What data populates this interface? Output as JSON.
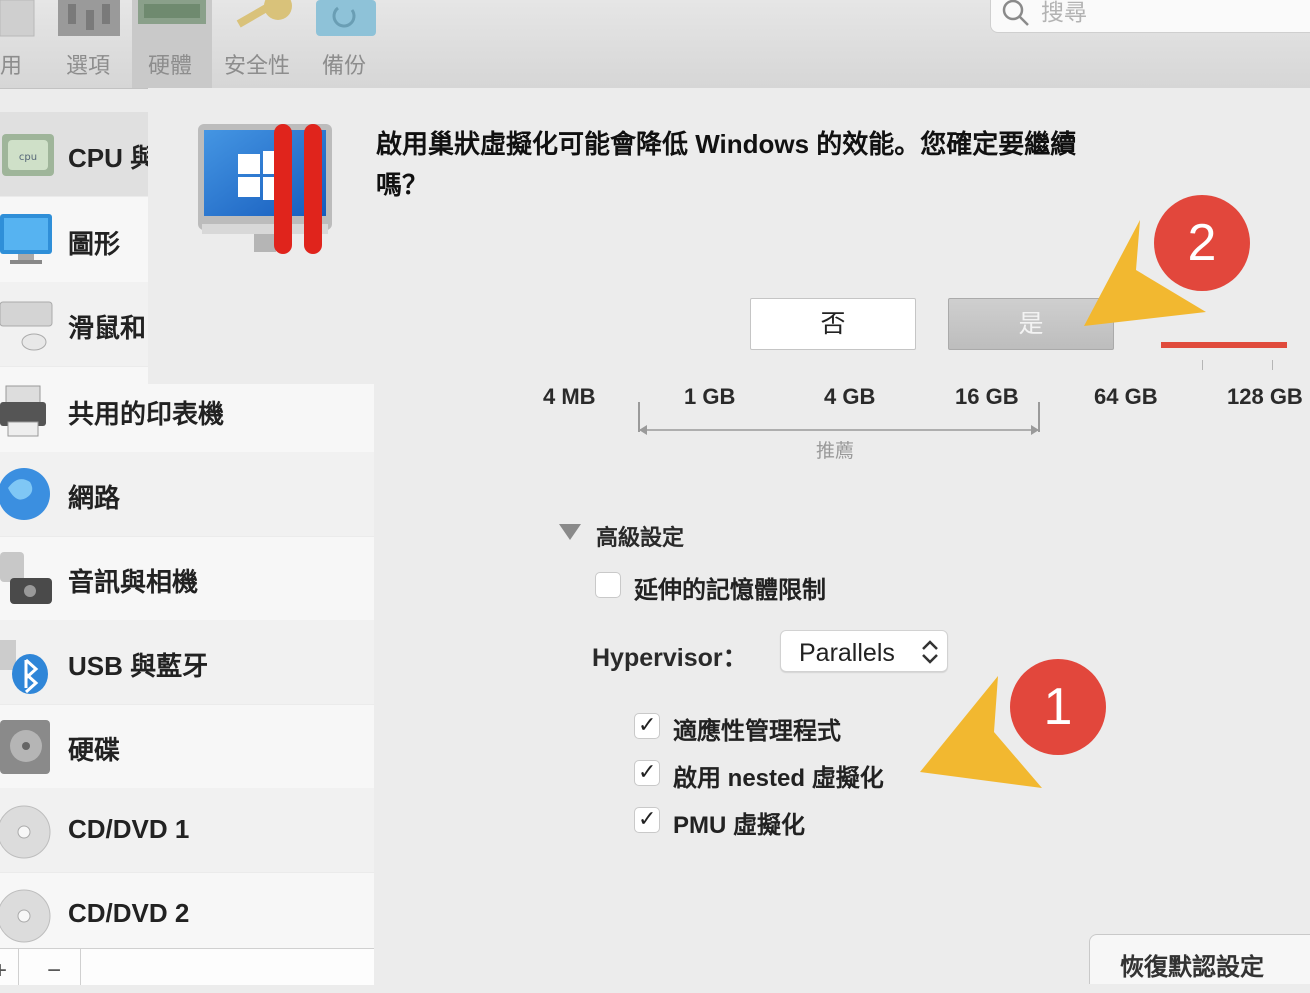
{
  "toolbar": {
    "items": [
      {
        "label": "用"
      },
      {
        "label": "選項"
      },
      {
        "label": "硬體"
      },
      {
        "label": "安全性"
      },
      {
        "label": "備份"
      }
    ],
    "search_placeholder": "搜尋"
  },
  "sidebar": {
    "items": [
      {
        "label": "CPU 與"
      },
      {
        "label": "圖形"
      },
      {
        "label": "滑鼠和"
      },
      {
        "label": "共用的印表機"
      },
      {
        "label": "網路"
      },
      {
        "label": "音訊與相機"
      },
      {
        "label": "USB 與藍牙"
      },
      {
        "label": "硬碟"
      },
      {
        "label": "CD/DVD 1"
      },
      {
        "label": "CD/DVD 2"
      }
    ],
    "footer": {
      "add": "+",
      "remove": "−"
    }
  },
  "dialog": {
    "message": "啟用巢狀虛擬化可能會降低 Windows 的效能。您確定要繼續嗎？",
    "no_label": "否",
    "yes_label": "是"
  },
  "memory": {
    "ticks": [
      "4 MB",
      "1 GB",
      "4 GB",
      "16 GB",
      "64 GB",
      "128 GB"
    ],
    "recommended_label": "推薦"
  },
  "advanced": {
    "title": "高級設定",
    "extended_memory_label": "延伸的記憶體限制",
    "extended_memory_checked": false,
    "hypervisor_label": "Hypervisor：",
    "hypervisor_value": "Parallels",
    "options": [
      {
        "label": "適應性管理程式",
        "checked": true
      },
      {
        "label": "啟用 nested 虛擬化",
        "checked": true
      },
      {
        "label": "PMU 虛擬化",
        "checked": true
      }
    ]
  },
  "restore_button": "恢復默認設定",
  "annotations": {
    "step1": "1",
    "step2": "2"
  },
  "colors": {
    "annotation_red": "#e2473c",
    "arrow_yellow": "#f2b830",
    "slider_red": "#e04b3c"
  }
}
